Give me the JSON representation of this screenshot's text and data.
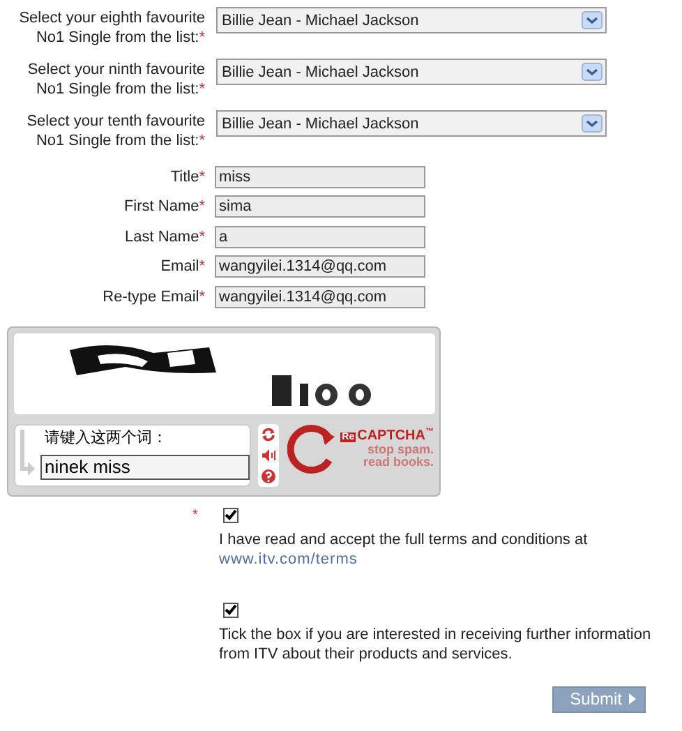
{
  "selects": [
    {
      "label": "Select your eighth favourite No1 Single from the list:",
      "mark": "*",
      "value": "Billie Jean - Michael Jackson"
    },
    {
      "label": "Select your ninth favourite No1 Single from the list:",
      "mark": "*",
      "value": "Billie Jean - Michael Jackson"
    },
    {
      "label": "Select your tenth favourite No1 Single from the list:",
      "mark": "*",
      "value": "Billie Jean - Michael Jackson"
    }
  ],
  "fields": [
    {
      "label": "Title",
      "mark": "*",
      "value": "miss"
    },
    {
      "label": "First Name",
      "mark": "*",
      "value": "sima"
    },
    {
      "label": "Last Name",
      "mark": "*",
      "value": "a"
    },
    {
      "label": "Email",
      "mark": "*",
      "value": "wangyilei.1314@qq.com"
    },
    {
      "label": "Re-type Email",
      "mark": "*",
      "value": "wangyilei.1314@qq.com"
    }
  ],
  "captcha": {
    "prompt": "请键入这两个词：",
    "value": "ninek miss",
    "logo_prefix": "Re",
    "logo_name": "CAPTCHA",
    "logo_tm": "™",
    "slogan_1": "stop spam.",
    "slogan_2": "read books."
  },
  "consents": [
    {
      "mark": "*",
      "checked": true,
      "text": "I have read and accept the full terms and conditions at",
      "link": "www.itv.com/terms"
    },
    {
      "checked": true,
      "text": "Tick the box if you are interested in receiving further information from ITV about their products and services."
    }
  ],
  "submit": {
    "label": "Submit"
  }
}
